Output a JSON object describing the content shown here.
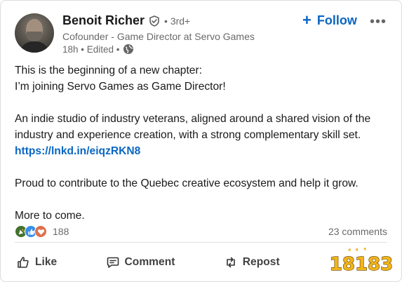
{
  "author": {
    "name": "Benoit Richer",
    "degree": "• 3rd+",
    "headline": "Cofounder - Game Director at Servo Games",
    "timestamp": "18h • Edited •",
    "verified_icon": "verified-shield-icon",
    "visibility_icon": "globe-icon"
  },
  "header": {
    "follow_label": "Follow",
    "more_icon": "ellipsis-icon"
  },
  "post": {
    "line1": "This is the beginning of a new chapter:",
    "line2": "I’m joining Servo Games as Game Director!",
    "para2": "An indie studio of industry veterans, aligned around a shared vision of the industry and experience creation, with a strong complementary skill set.",
    "link": "https://lnkd.in/eiqzRKN8",
    "para3": "Proud to contribute to the Quebec creative ecosystem and help it grow.",
    "para4": "More to come."
  },
  "social": {
    "reaction_icons": [
      "celebrate-icon",
      "like-icon",
      "love-icon"
    ],
    "reaction_count": "188",
    "comments_count": "23 comments"
  },
  "actions": {
    "like": "Like",
    "comment": "Comment",
    "repost": "Repost"
  },
  "watermark": {
    "text": "18183"
  },
  "colors": {
    "link": "#0a66c2",
    "celebrate": "#44712e",
    "like": "#378fe9",
    "love": "#df704d"
  }
}
